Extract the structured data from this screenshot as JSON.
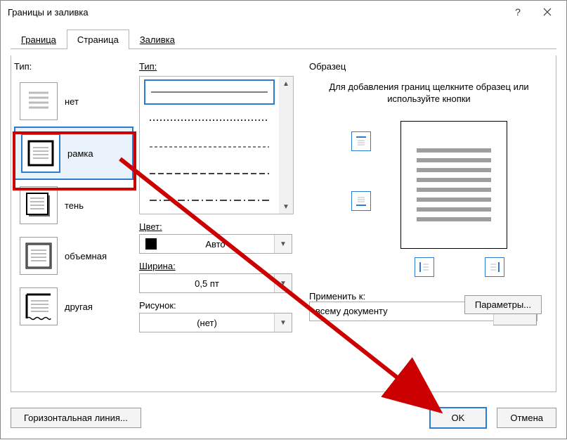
{
  "window": {
    "title": "Границы и заливка"
  },
  "tabs": {
    "border": "Граница",
    "page": "Страница",
    "fill": "Заливка"
  },
  "left": {
    "label": "Тип:",
    "items": {
      "none": "нет",
      "box": "рамка",
      "shadow": "тень",
      "threeD": "объемная",
      "custom": "другая"
    }
  },
  "mid": {
    "type_label": "Тип:",
    "color_label": "Цвет:",
    "color_value": "Авто",
    "width_label": "Ширина:",
    "width_value": "0,5 пт",
    "art_label": "Рисунок:",
    "art_value": "(нет)"
  },
  "right": {
    "label": "Образец",
    "hint": "Для добавления границ щелкните образец или используйте кнопки",
    "apply_label": "Применить к:",
    "apply_value": "всему документу",
    "params_btn": "Параметры..."
  },
  "bottom": {
    "hline": "Горизонтальная линия...",
    "ok": "OK",
    "cancel": "Отмена"
  }
}
